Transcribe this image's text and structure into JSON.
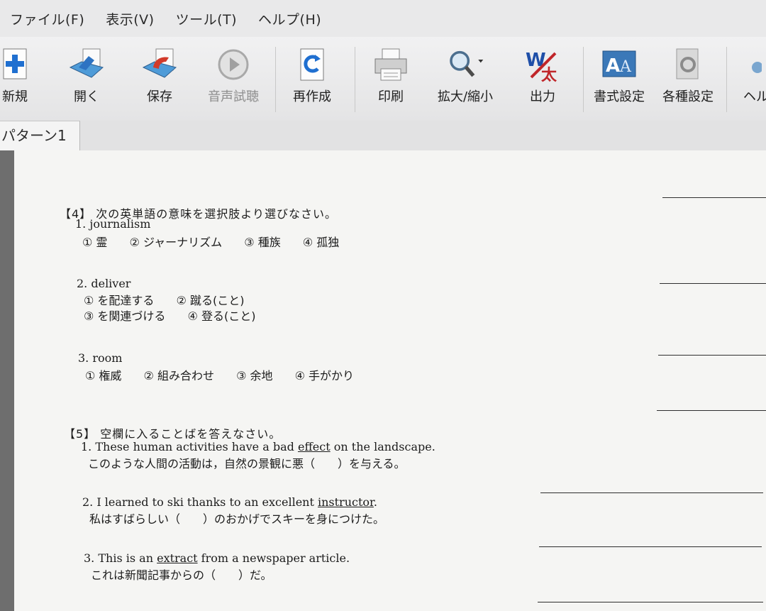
{
  "menu": [
    "ファイル(F)",
    "表示(V)",
    "ツール(T)",
    "ヘルプ(H)"
  ],
  "toolbar": {
    "new": "新規",
    "open": "開く",
    "save": "保存",
    "audio": "音声試聴",
    "regenerate": "再作成",
    "print": "印刷",
    "zoom": "拡大/縮小",
    "output": "出力",
    "format": "書式設定",
    "settings": "各種設定",
    "help": "ヘル"
  },
  "tab": {
    "label": "パターン1"
  },
  "section4": {
    "heading": "【4】 次の英単語の意味を選択肢より選びなさい。",
    "q1": {
      "word": "1. journalism",
      "choices": [
        "① 霊",
        "② ジャーナリズム",
        "③ 種族",
        "④ 孤独"
      ]
    },
    "q2": {
      "word": "2. deliver",
      "choices_line1": [
        "① を配達する",
        "② 蹴る(こと)"
      ],
      "choices_line2": [
        "③ を関連づける",
        "④ 登る(こと)"
      ]
    },
    "q3": {
      "word": "3. room",
      "choices": [
        "① 権威",
        "② 組み合わせ",
        "③ 余地",
        "④ 手がかり"
      ]
    }
  },
  "section5": {
    "heading": "【5】 空欄に入ることばを答えなさい。",
    "q1": {
      "pre": "1. These human activities have a bad ",
      "key": "effect",
      "post": " on the landscape.",
      "jp": "このような人間の活動は，自然の景観に悪（　　）を与える。"
    },
    "q2": {
      "pre": "2. I learned to ski thanks to an excellent ",
      "key": "instructor",
      "post": ".",
      "jp": "私はすばらしい（　　）のおかげでスキーを身につけた。"
    },
    "q3": {
      "pre": "3. This is an ",
      "key": "extract",
      "post": " from a newspaper article.",
      "jp": "これは新聞記事からの（　　）だ。"
    }
  },
  "colors": {
    "new_icon": "#1f6fd0",
    "save_icon": "#d23a2a",
    "output_icon": "#c0262a",
    "page_bg": "#f5f5f3"
  }
}
